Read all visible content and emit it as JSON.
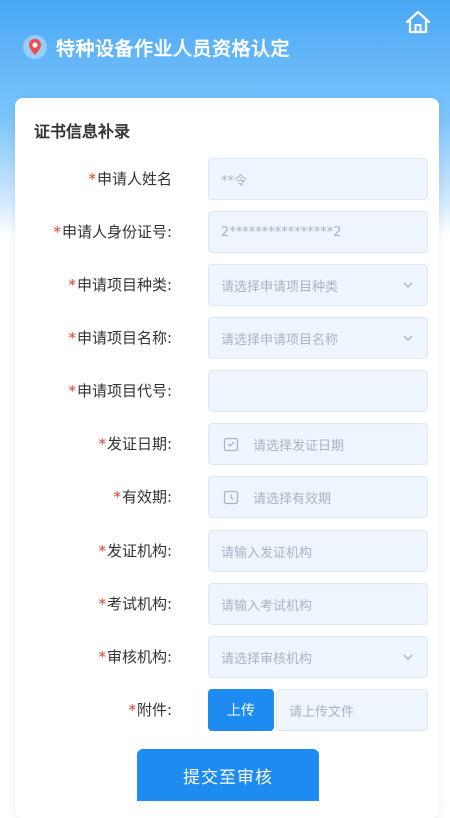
{
  "header": {
    "title": "特种设备作业人员资格认定",
    "pin_icon": "location-pin-icon",
    "home_icon": "home-icon"
  },
  "form": {
    "section_title": "证书信息补录",
    "required_mark": "*",
    "fields": [
      {
        "label": "申请人姓名",
        "value": "**令",
        "type": "text"
      },
      {
        "label": "申请人身份证号:",
        "value": "2****************2",
        "type": "text"
      },
      {
        "label": "申请项目种类:",
        "placeholder": "请选择申请项目种类",
        "type": "select"
      },
      {
        "label": "申请项目名称:",
        "placeholder": "请选择申请项目名称",
        "type": "select"
      },
      {
        "label": "申请项目代号:",
        "placeholder": "",
        "type": "text"
      },
      {
        "label": "发证日期:",
        "placeholder": "请选择发证日期",
        "type": "date"
      },
      {
        "label": "有效期:",
        "placeholder": "请选择有效期",
        "type": "date"
      },
      {
        "label": "发证机构:",
        "placeholder": "请输入发证机构",
        "type": "text"
      },
      {
        "label": "考试机构:",
        "placeholder": "请输入考试机构",
        "type": "text"
      },
      {
        "label": "审核机构:",
        "placeholder": "请选择审核机构",
        "type": "select"
      }
    ],
    "attachment": {
      "label": "附件:",
      "upload_label": "上传",
      "placeholder": "请上传文件"
    },
    "submit_label": "提交至审核"
  },
  "colors": {
    "primary": "#1e8bf0",
    "required": "#e8382f",
    "header_top": "#4aa8f5",
    "field_bg": "#eef5fc"
  }
}
